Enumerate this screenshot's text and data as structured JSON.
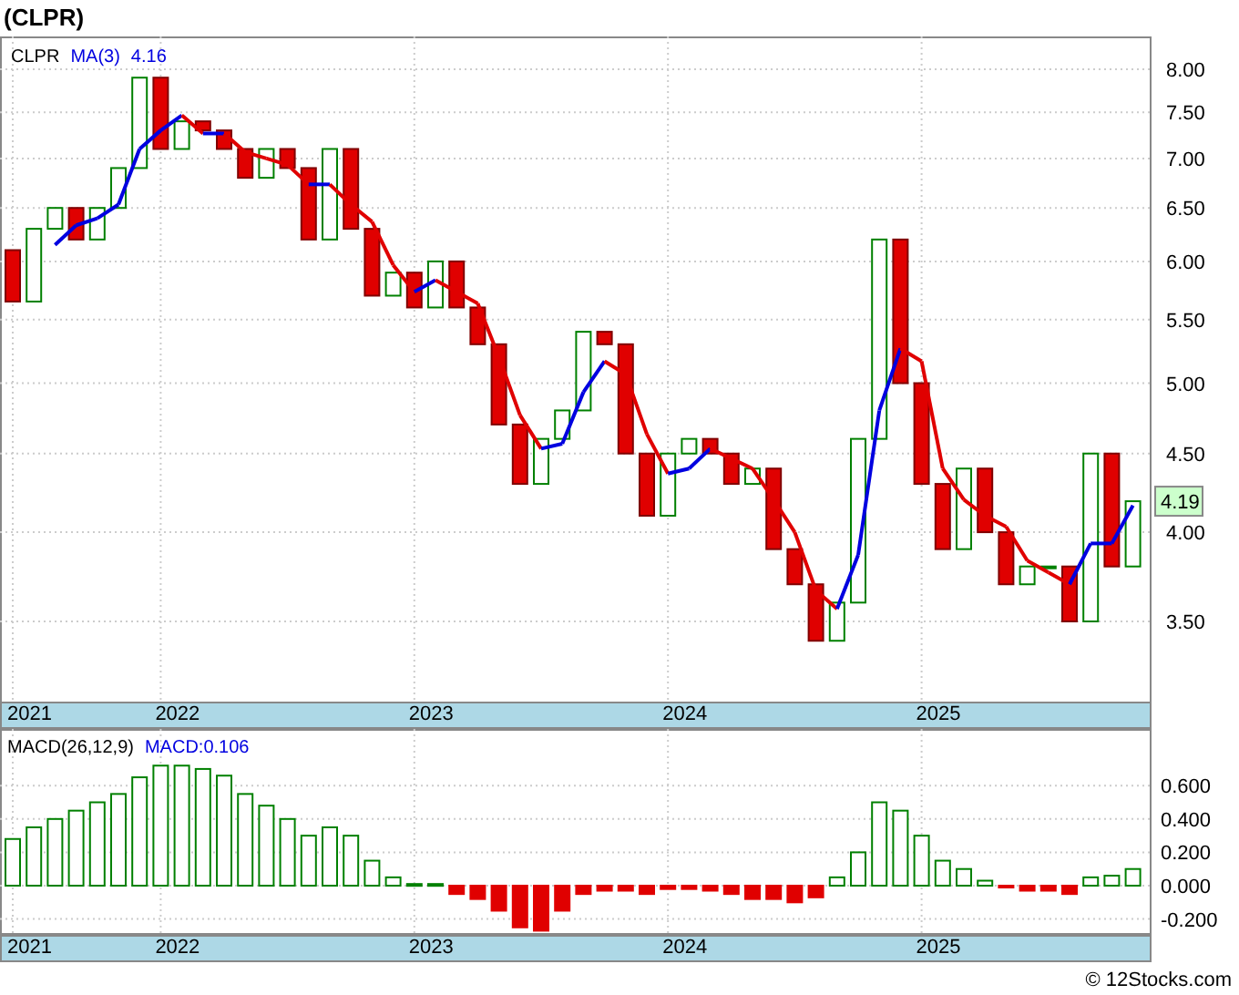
{
  "title": "(CLPR)",
  "watermark_credit": "© 12Stocks.com",
  "price_panel": {
    "legend": {
      "symbol": "CLPR",
      "ma_label": "MA(3)",
      "ma_value": "4.16"
    },
    "last_price": "4.19",
    "price_axis": [
      "8.00",
      "7.50",
      "7.00",
      "6.50",
      "6.00",
      "5.50",
      "5.00",
      "4.50",
      "4.00",
      "3.50"
    ],
    "date_axis": [
      "2021",
      "2022",
      "2023",
      "2024",
      "2025"
    ]
  },
  "macd_panel": {
    "legend_value": "MACD:0.106",
    "chart_data": {
      "type": "bar",
      "grid": true,
      "ylim": [
        -0.295,
        0.94
      ],
      "yticks": [
        {
          "value": 0.6,
          "label": "0.600"
        },
        {
          "value": 0.4,
          "label": "0.400"
        },
        {
          "value": 0.2,
          "label": "0.200"
        },
        {
          "value": 0,
          "label": "0.000"
        },
        {
          "value": -0.2,
          "label": "-0.200"
        }
      ],
      "series": [
        {
          "name": "MACD(26,12,9)",
          "color": "#008000",
          "values": [
            0.28,
            0.35,
            0.4,
            0.45,
            0.5,
            0.55,
            0.65,
            0.72,
            0.72,
            0.7,
            0.66,
            0.55,
            0.48,
            0.4,
            0.3,
            0.35,
            0.3,
            0.15,
            0.05,
            0.01,
            0.01,
            null,
            null,
            null,
            null,
            null,
            null,
            null,
            null,
            null,
            null,
            null,
            null,
            null,
            null,
            null,
            null,
            null,
            null,
            0.05,
            0.2,
            0.5,
            0.45,
            0.3,
            0.15,
            0.1,
            0.03,
            null,
            null,
            null,
            null,
            0.05,
            0.06,
            0.1
          ]
        },
        {
          "color": "#e00000",
          "values": [
            null,
            null,
            null,
            null,
            null,
            null,
            null,
            null,
            null,
            null,
            null,
            null,
            null,
            null,
            null,
            null,
            null,
            null,
            null,
            null,
            null,
            -0.05,
            -0.08,
            -0.15,
            -0.25,
            -0.27,
            -0.15,
            -0.05,
            -0.03,
            -0.03,
            -0.05,
            -0.02,
            -0.02,
            -0.03,
            -0.05,
            -0.08,
            -0.08,
            -0.1,
            -0.07,
            null,
            null,
            null,
            null,
            null,
            null,
            null,
            null,
            -0.01,
            -0.03,
            -0.03,
            -0.05,
            null,
            null,
            null
          ]
        }
      ]
    },
    "date_axis": [
      "2021",
      "2022",
      "2023",
      "2024",
      "2025"
    ]
  }
}
